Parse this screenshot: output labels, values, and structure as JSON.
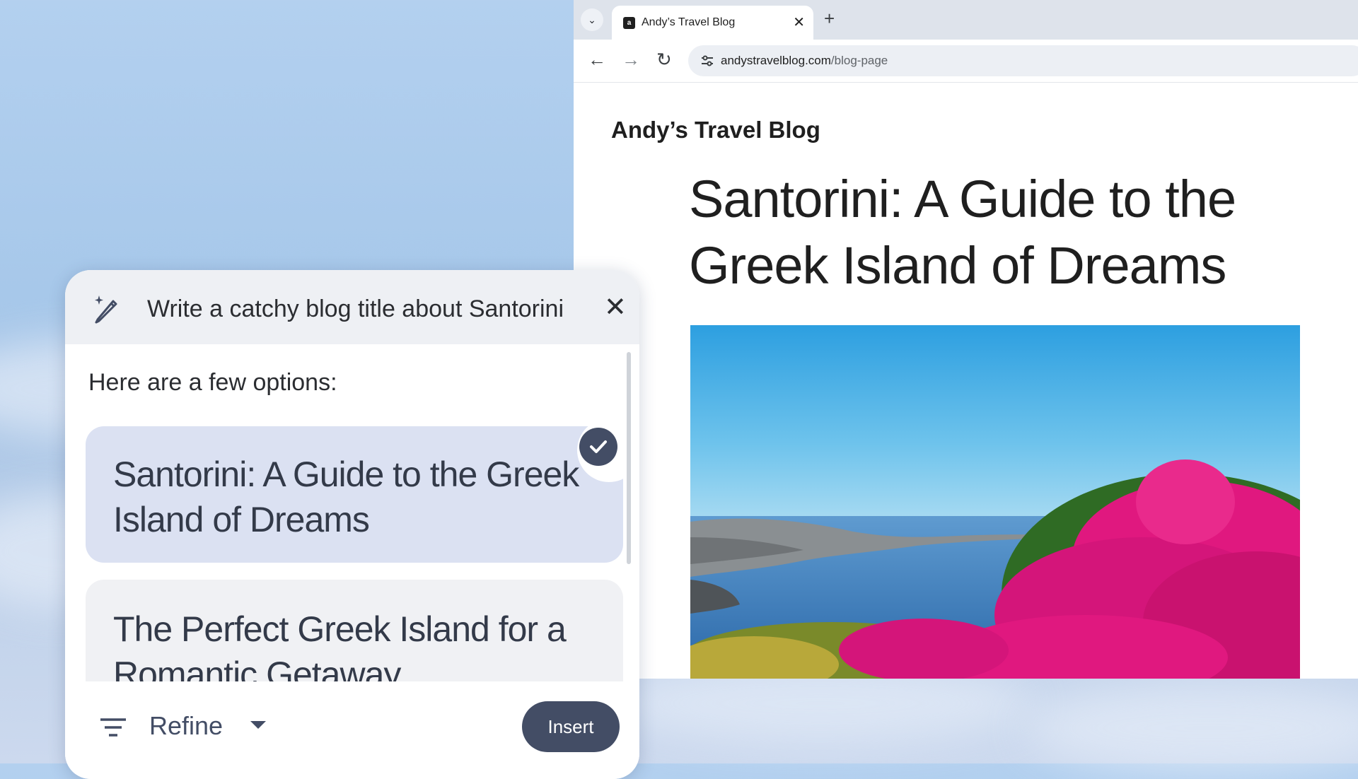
{
  "browser": {
    "tab": {
      "title": "Andy’s Travel Blog",
      "favicon": "a"
    },
    "new_tab": "+",
    "omnibox": {
      "domain": "andystravelblog.com",
      "path": "/blog-page"
    }
  },
  "page": {
    "blog_name": "Andy’s Travel Blog",
    "title": "Santorini: A Guide to the Greek Island of Dreams",
    "hero_image": "santorini-coast-with-pink-bougainvillea"
  },
  "dialog": {
    "prompt": "Write a catchy blog title about Santorini",
    "intro": "Here are a few options:",
    "options": [
      {
        "text": "Santorini: A Guide to the Greek Island of Dreams",
        "selected": true
      },
      {
        "text": "The Perfect Greek Island for a Romantic Getaway",
        "selected": false
      }
    ],
    "refine_label": "Refine",
    "insert_label": "Insert"
  },
  "colors": {
    "accent": "#434d65",
    "selected_option_bg": "#dbe1f2",
    "desktop_bg": "#a7c8ea",
    "sea": "#2e6aa8",
    "bougainvillea": "#e0187f"
  },
  "icons": [
    "pen-sparkle-icon",
    "close-icon",
    "check-icon",
    "filter-icon",
    "chevron-down-icon",
    "back-arrow-icon",
    "forward-arrow-icon",
    "reload-icon",
    "site-settings-icon",
    "tab-search-icon"
  ]
}
